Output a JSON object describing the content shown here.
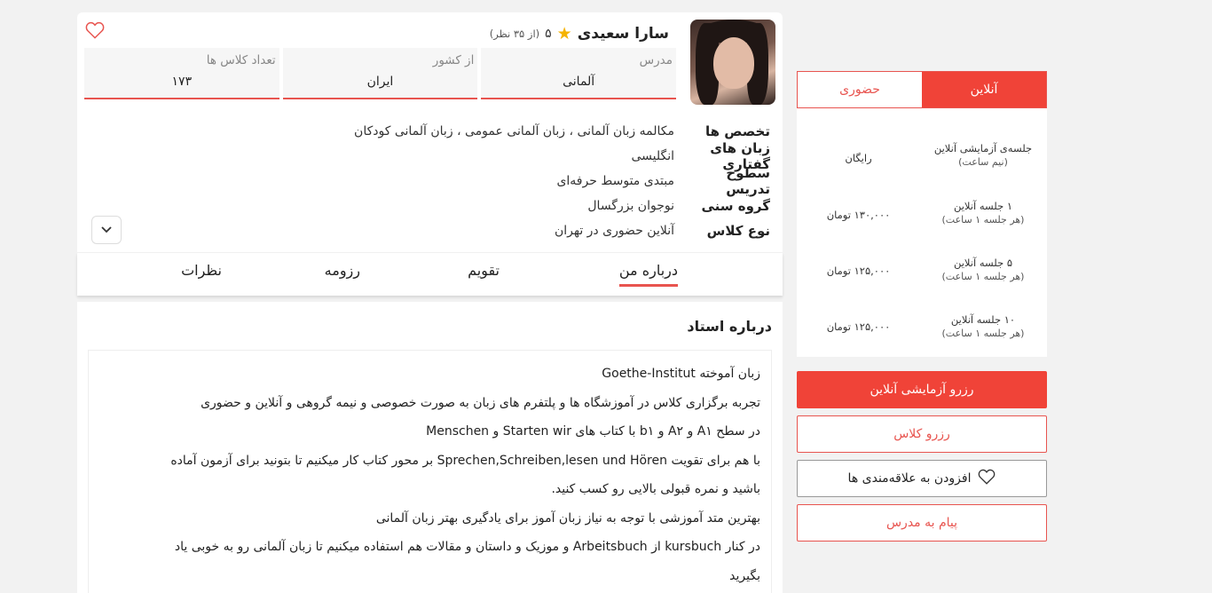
{
  "teacher": {
    "name": "سارا سعیدی",
    "rating": "۵",
    "rating_count": "(از ۳۵ نظر)"
  },
  "stats": [
    {
      "label": "مدرس",
      "value": "آلمانی"
    },
    {
      "label": "از کشور",
      "value": "ایران"
    },
    {
      "label": "تعداد کلاس ها",
      "value": "۱۷۳"
    }
  ],
  "specs": [
    {
      "label": "تخصص ها",
      "value": "مکالمه زبان آلمانی ، زبان آلمانی عمومی ، زبان آلمانی کودکان"
    },
    {
      "label": "زبان های گفتاری",
      "value": "انگلیسی"
    },
    {
      "label": "سطوح تدریس",
      "value": "مبتدی  متوسط  حرفه‌ای"
    },
    {
      "label": "گروه سنی",
      "value": "نوجوان  بزرگسال"
    },
    {
      "label": "نوع کلاس",
      "value": "آنلاین  حضوری در تهران"
    }
  ],
  "tabs": [
    {
      "label": "درباره من",
      "active": true
    },
    {
      "label": "تقویم",
      "active": false
    },
    {
      "label": "رزومه",
      "active": false
    },
    {
      "label": "نظرات",
      "active": false
    }
  ],
  "about": {
    "title": "درباره استاد",
    "lines": [
      "زبان آموخته Goethe-Institut",
      "تجربه برگزاری کلاس در آموزشگاه ها و پلتفرم های زبان به صورت خصوصی و نیمه گروهی و آنلاین و حضوری",
      "در سطح A۱ و A۲ و b۱ با کتاب های Starten wir و Menschen",
      "با هم برای تقویت Sprechen,Schreiben,lesen und Hören  بر محور کتاب کار میکنیم تا بتونید برای آزمون آماده",
      "باشید و نمره قبولی بالایی رو کسب کنید.",
      "بهترین متد آموزشی با توجه به نیاز زبان آموز برای یادگیری بهتر زبان آلمانی",
      "در کنار kursbuch  از Arbeitsbuch و موزیک و داستان و مقالات هم استفاده میکنیم تا زبان آلمانی رو به خوبی یاد",
      "بگیرید"
    ]
  },
  "mode_tabs": {
    "online": "آنلاین",
    "in_person": "حضوری"
  },
  "prices": [
    {
      "title": "جلسه‌ی آزمایشی آنلاین",
      "sub": "(نیم ساعت)",
      "price": "رایگان"
    },
    {
      "title": "۱ جلسه آنلاین",
      "sub": "(هر جلسه ۱ ساعت)",
      "price": "۱۳۰,۰۰۰ تومان"
    },
    {
      "title": "۵ جلسه آنلاین",
      "sub": "(هر جلسه ۱ ساعت)",
      "price": "۱۲۵,۰۰۰ تومان"
    },
    {
      "title": "۱۰ جلسه آنلاین",
      "sub": "(هر جلسه ۱ ساعت)",
      "price": "۱۲۵,۰۰۰ تومان"
    }
  ],
  "buttons": {
    "book_trial": "رزرو آزمایشی آنلاین",
    "book_class": "رزرو کلاس",
    "add_favorite": "افزودن به علاقه‌مندی ها",
    "message_teacher": "پیام به مدرس"
  },
  "colors": {
    "accent": "#f04338",
    "accent_text": "#e8544f"
  }
}
